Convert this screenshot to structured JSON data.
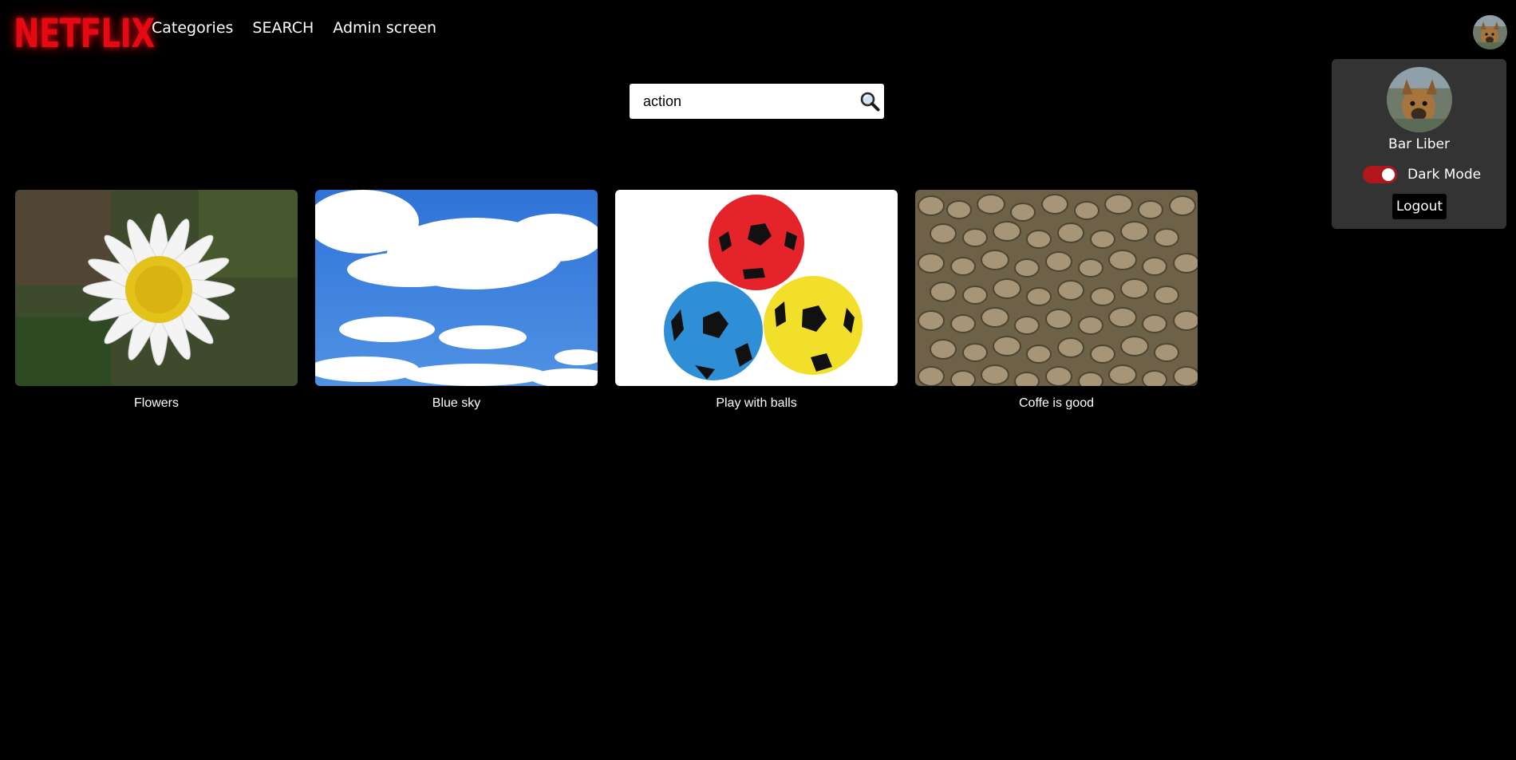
{
  "header": {
    "logo_text": "NETFLIX",
    "nav": [
      {
        "label": "Categories"
      },
      {
        "label": "SEARCH"
      },
      {
        "label": "Admin screen"
      }
    ]
  },
  "search": {
    "value": "action",
    "icon": "magnifier-icon"
  },
  "results": [
    {
      "title": "Flowers",
      "image": "daisy-flower-photo"
    },
    {
      "title": "Blue sky",
      "image": "cloudy-blue-sky-photo"
    },
    {
      "title": "Play with balls",
      "image": "three-soccer-balls-photo"
    },
    {
      "title": "Coffe is good",
      "image": "coffee-beans-photo"
    }
  ],
  "profile_menu": {
    "user_name": "Bar Liber",
    "dark_mode_label": "Dark Mode",
    "dark_mode_on": true,
    "logout_label": "Logout"
  },
  "colors": {
    "background": "#000000",
    "brand": "#e50914",
    "menu_bg": "#333333",
    "toggle_on": "#b1161c"
  }
}
